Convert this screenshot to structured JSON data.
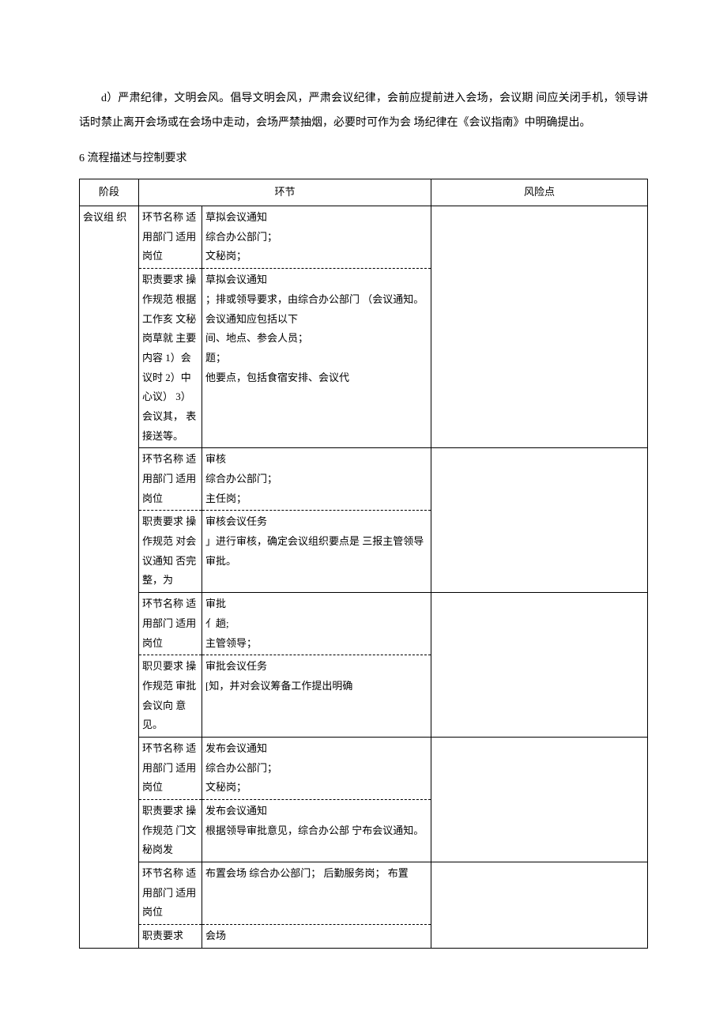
{
  "para_d": "d）严肃纪律，文明会风。倡导文明会风，严肃会议纪律，会前应提前进入会场，会议期 间应关闭手机，领导讲话时禁止离开会场或在会场中走动，会场严禁抽烟，必要时可作为会 场纪律在《会议指南》中明确提出。",
  "section6": "6 流程描述与控制要求",
  "hdr": {
    "stage": "阶段",
    "link": "环节",
    "risk": "风险点"
  },
  "stage1": "会议组  织",
  "r1": {
    "l1": "环节名称 适用部门 适用岗位",
    "l2": "职责要求 操作规范 根据工作亥 文秘岗草就 主要内容   1）会议时  2）中心议）  3）会议其，   表接送等。",
    "m1a": "草拟会议通知",
    "m1b": "综合办公部门；",
    "m1c": "文秘岗；",
    "m2a": "草拟会议通知",
    "m2b": "；排或领导要求，由综合办公部门 （会议通知。会议通知应包括以下",
    "m2c": "间、地点、参会人员；",
    "m2d": "题；",
    "m2e": "他要点，包括食宿安排、会议代"
  },
  "r2": {
    "l1": "环节名称 适用部门 适用岗位",
    "l2": "职责要求 操作规范 对会议通知 否完整，为",
    "m1a": "审核",
    "m1b": "综合办公部门；",
    "m1c": "主任岗；",
    "m2a": "审核会议任务",
    "m2b": "」进行审核，确定会议组织要点是 三报主管领导审批。"
  },
  "r3": {
    "l1": "环节名称 适用部门 适用岗位",
    "l2": "职贝要求 操作规范 审批会议向 意见。",
    "m1a": "审批",
    "m1b": "亻趟;",
    "m1c": "主管领导；",
    "m2a": "审批会议任务",
    "m2b": "[知，并对会议筹备工作提出明确"
  },
  "r4": {
    "l1": "环节名称 适用部门 适用岗位",
    "l2": "职责要求 操作规范 门文秘岗发",
    "m1a": "发布会议通知",
    "m1b": "综合办公部门；",
    "m1c": "文秘岗；",
    "m2a": "发布会议通知",
    "m2b": "根据领导审批意见，综合办公部 宁布会议通知。"
  },
  "r5": {
    "l1": "环节名称 适用部门 适用岗位",
    "l2": "职责要求",
    "m1a": "",
    "m1b": "布置会场 综合办公部门； 后勤服务岗； 布置",
    "m2a": "会场"
  }
}
